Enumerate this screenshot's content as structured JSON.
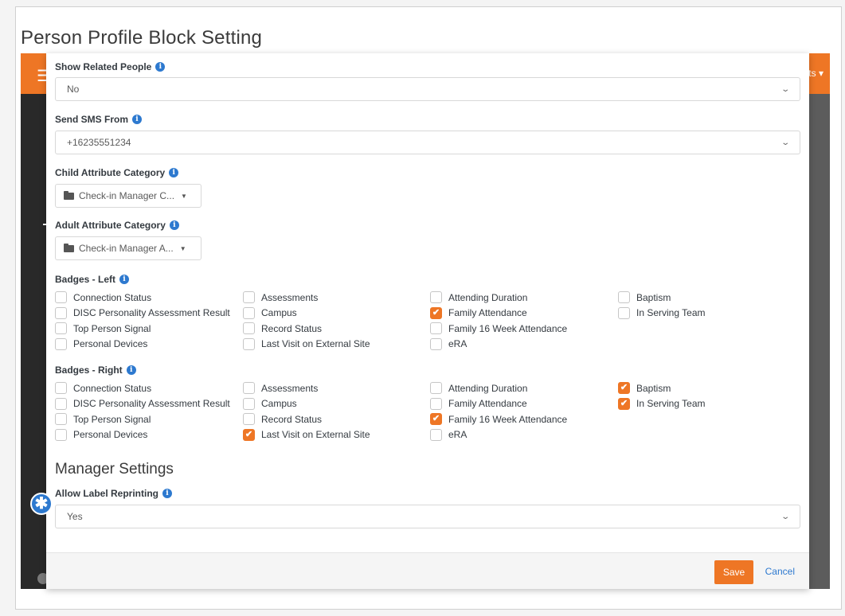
{
  "page": {
    "title": "Person Profile Block Setting"
  },
  "background_app": {
    "menu_icon": "hamburger-icon",
    "right_label": "ts"
  },
  "fields": {
    "show_related_people": {
      "label": "Show Related People",
      "value": "No"
    },
    "send_sms_from": {
      "label": "Send SMS From",
      "value": "+16235551234"
    },
    "child_attribute_category": {
      "label": "Child Attribute Category",
      "value": "Check-in Manager C..."
    },
    "adult_attribute_category": {
      "label": "Adult Attribute Category",
      "value": "Check-in Manager A..."
    }
  },
  "badges_left": {
    "label": "Badges - Left",
    "rows": [
      [
        {
          "label": "Connection Status",
          "checked": false
        },
        {
          "label": "Assessments",
          "checked": false
        },
        {
          "label": "Attending Duration",
          "checked": false
        },
        {
          "label": "Baptism",
          "checked": false
        }
      ],
      [
        {
          "label": "DISC Personality Assessment Result",
          "checked": false
        },
        {
          "label": "Campus",
          "checked": false
        },
        {
          "label": "Family Attendance",
          "checked": true
        },
        {
          "label": "In Serving Team",
          "checked": false
        }
      ],
      [
        {
          "label": "Top Person Signal",
          "checked": false
        },
        {
          "label": "Record Status",
          "checked": false
        },
        {
          "label": "Family 16 Week Attendance",
          "checked": false
        }
      ],
      [
        {
          "label": "Personal Devices",
          "checked": false
        },
        {
          "label": "Last Visit on External Site",
          "checked": false
        },
        {
          "label": "eRA",
          "checked": false
        }
      ]
    ]
  },
  "badges_right": {
    "label": "Badges - Right",
    "rows": [
      [
        {
          "label": "Connection Status",
          "checked": false
        },
        {
          "label": "Assessments",
          "checked": false
        },
        {
          "label": "Attending Duration",
          "checked": false
        },
        {
          "label": "Baptism",
          "checked": true
        }
      ],
      [
        {
          "label": "DISC Personality Assessment Result",
          "checked": false
        },
        {
          "label": "Campus",
          "checked": false
        },
        {
          "label": "Family Attendance",
          "checked": false
        },
        {
          "label": "In Serving Team",
          "checked": true
        }
      ],
      [
        {
          "label": "Top Person Signal",
          "checked": false
        },
        {
          "label": "Record Status",
          "checked": false
        },
        {
          "label": "Family 16 Week Attendance",
          "checked": true
        }
      ],
      [
        {
          "label": "Personal Devices",
          "checked": false
        },
        {
          "label": "Last Visit on External Site",
          "checked": true
        },
        {
          "label": "eRA",
          "checked": false
        }
      ]
    ]
  },
  "manager_settings": {
    "heading": "Manager Settings",
    "allow_label_reprinting": {
      "label": "Allow Label Reprinting",
      "value": "Yes"
    }
  },
  "footer": {
    "save_label": "Save",
    "cancel_label": "Cancel"
  },
  "colors": {
    "accent": "#ee7625",
    "link": "#2d79cf",
    "info": "#2d79cf"
  },
  "icons": {
    "info": "info-circle-icon",
    "folder": "folder-open-icon",
    "chevron": "chevron-down-icon",
    "caret": "caret-down-icon",
    "check": "check-icon",
    "fab": "asterisk-icon"
  }
}
